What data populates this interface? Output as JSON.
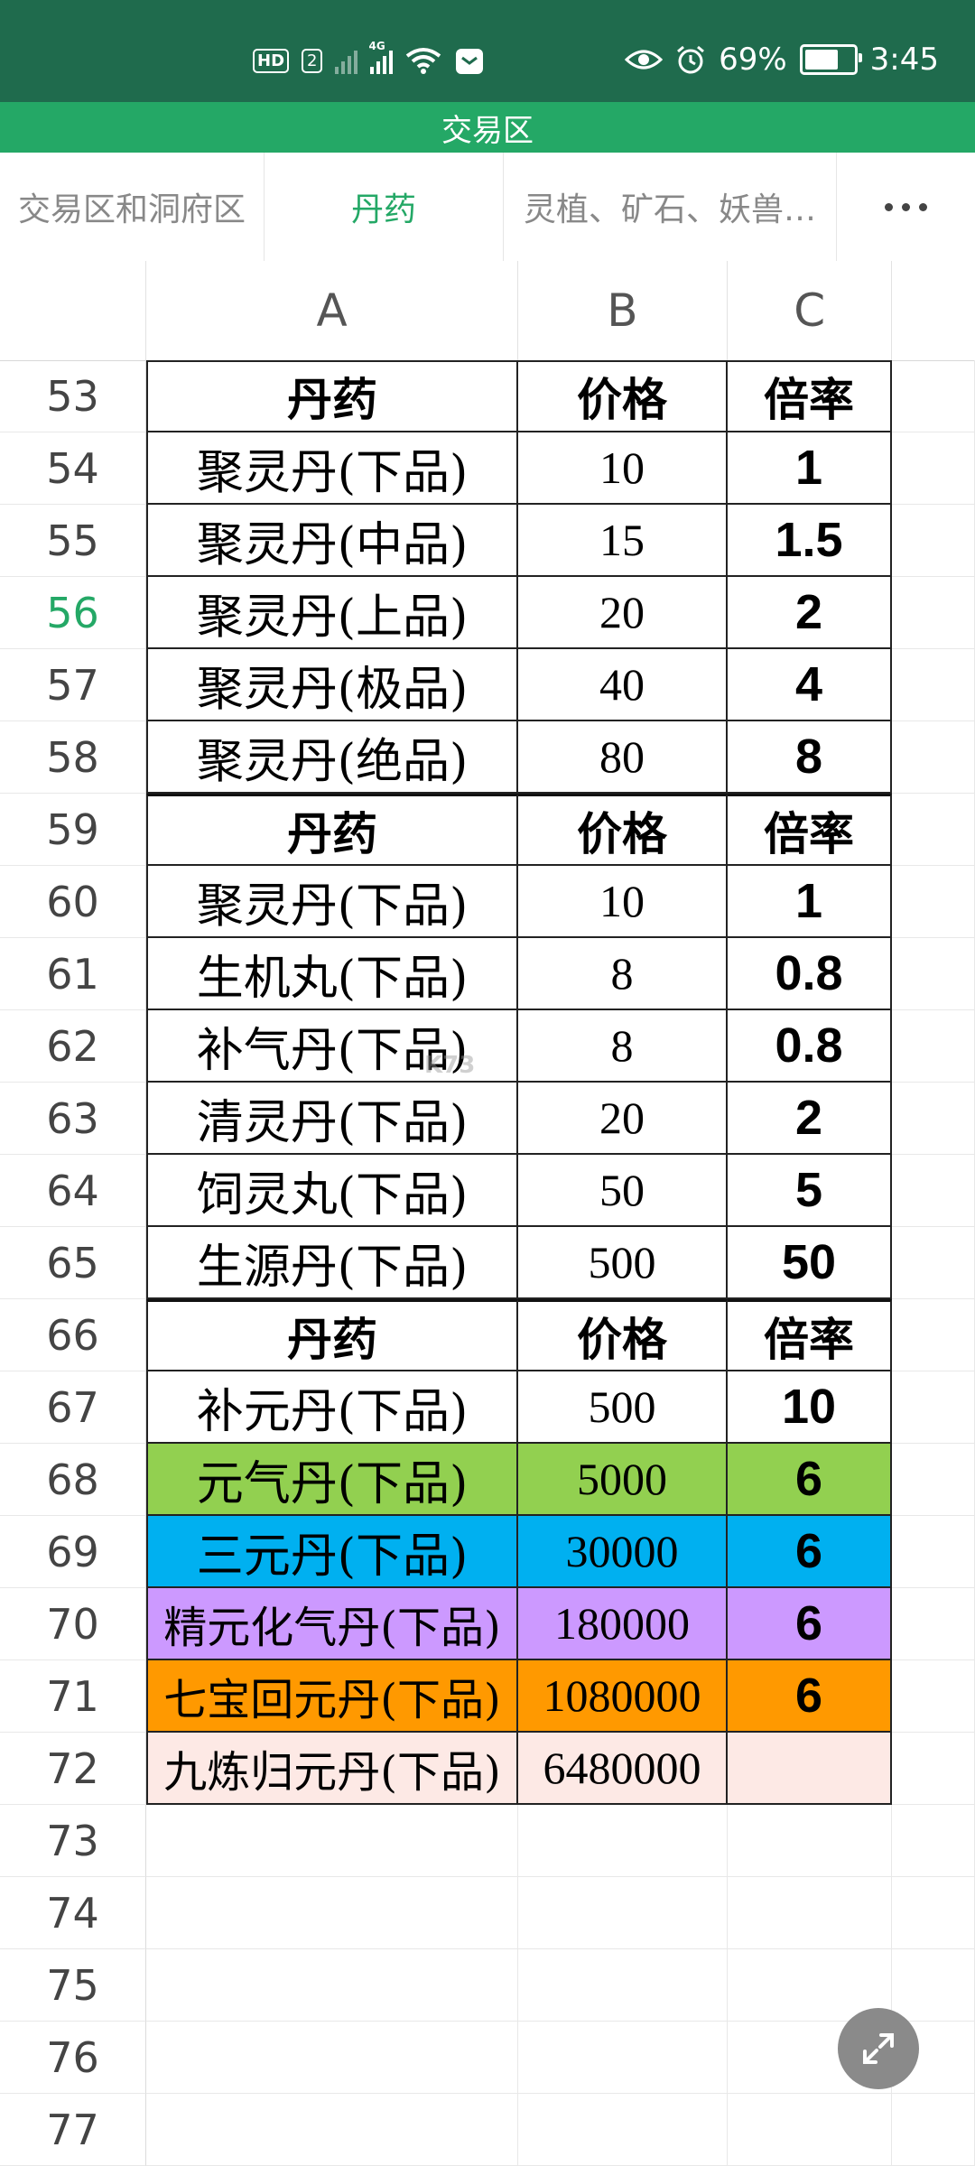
{
  "status_bar": {
    "hd": "HD",
    "sim": "2",
    "signal_label": "4G",
    "battery_percent": "69%",
    "battery_level": 0.69,
    "time": "3:45"
  },
  "title_bar": {
    "title": "交易区"
  },
  "tabs": [
    {
      "label": "交易区和洞府区",
      "active": false
    },
    {
      "label": "丹药",
      "active": true
    },
    {
      "label": "灵植、矿石、妖兽…",
      "active": false
    }
  ],
  "columns": [
    "A",
    "B",
    "C"
  ],
  "active_row": "56",
  "rows": [
    {
      "num": "53",
      "a": "丹药",
      "b": "价格",
      "c": "倍率",
      "kind": "header",
      "bg": ""
    },
    {
      "num": "54",
      "a": "聚灵丹(下品)",
      "b": "10",
      "c": "1",
      "kind": "data",
      "bg": ""
    },
    {
      "num": "55",
      "a": "聚灵丹(中品)",
      "b": "15",
      "c": "1.5",
      "kind": "data",
      "bg": ""
    },
    {
      "num": "56",
      "a": "聚灵丹(上品)",
      "b": "20",
      "c": "2",
      "kind": "data",
      "bg": ""
    },
    {
      "num": "57",
      "a": "聚灵丹(极品)",
      "b": "40",
      "c": "4",
      "kind": "data",
      "bg": ""
    },
    {
      "num": "58",
      "a": "聚灵丹(绝品)",
      "b": "80",
      "c": "8",
      "kind": "data",
      "bg": ""
    },
    {
      "num": "59",
      "a": "丹药",
      "b": "价格",
      "c": "倍率",
      "kind": "header",
      "bg": ""
    },
    {
      "num": "60",
      "a": "聚灵丹(下品)",
      "b": "10",
      "c": "1",
      "kind": "data",
      "bg": ""
    },
    {
      "num": "61",
      "a": "生机丸(下品)",
      "b": "8",
      "c": "0.8",
      "kind": "data",
      "bg": ""
    },
    {
      "num": "62",
      "a": "补气丹(下品)",
      "b": "8",
      "c": "0.8",
      "kind": "data",
      "bg": ""
    },
    {
      "num": "63",
      "a": "清灵丹(下品)",
      "b": "20",
      "c": "2",
      "kind": "data",
      "bg": ""
    },
    {
      "num": "64",
      "a": "饲灵丸(下品)",
      "b": "50",
      "c": "5",
      "kind": "data",
      "bg": ""
    },
    {
      "num": "65",
      "a": "生源丹(下品)",
      "b": "500",
      "c": "50",
      "kind": "data",
      "bg": ""
    },
    {
      "num": "66",
      "a": "丹药",
      "b": "价格",
      "c": "倍率",
      "kind": "header",
      "bg": ""
    },
    {
      "num": "67",
      "a": "补元丹(下品)",
      "b": "500",
      "c": "10",
      "kind": "data",
      "bg": ""
    },
    {
      "num": "68",
      "a": "元气丹(下品)",
      "b": "5000",
      "c": "6",
      "kind": "data",
      "bg": "#92d050"
    },
    {
      "num": "69",
      "a": "三元丹(下品)",
      "b": "30000",
      "c": "6",
      "kind": "data",
      "bg": "#00b0f0"
    },
    {
      "num": "70",
      "a": "精元化气丹(下品)",
      "b": "180000",
      "c": "6",
      "kind": "data",
      "bg": "#cc99ff"
    },
    {
      "num": "71",
      "a": "七宝回元丹(下品)",
      "b": "1080000",
      "c": "6",
      "kind": "data",
      "bg": "#ff9900"
    },
    {
      "num": "72",
      "a": "九炼归元丹(下品)",
      "b": "6480000",
      "c": "",
      "kind": "data",
      "bg": "#fde9e5"
    },
    {
      "num": "73",
      "a": "",
      "b": "",
      "c": "",
      "kind": "empty",
      "bg": ""
    },
    {
      "num": "74",
      "a": "",
      "b": "",
      "c": "",
      "kind": "empty",
      "bg": ""
    },
    {
      "num": "75",
      "a": "",
      "b": "",
      "c": "",
      "kind": "empty",
      "bg": ""
    },
    {
      "num": "76",
      "a": "",
      "b": "",
      "c": "",
      "kind": "empty",
      "bg": ""
    },
    {
      "num": "77",
      "a": "",
      "b": "",
      "c": "",
      "kind": "empty",
      "bg": ""
    }
  ],
  "icons": {
    "eye": "eye-icon",
    "alarm": "alarm-icon",
    "wifi": "wifi-icon",
    "expand": "expand-icon",
    "more": "more-icon"
  },
  "watermark": "K73"
}
